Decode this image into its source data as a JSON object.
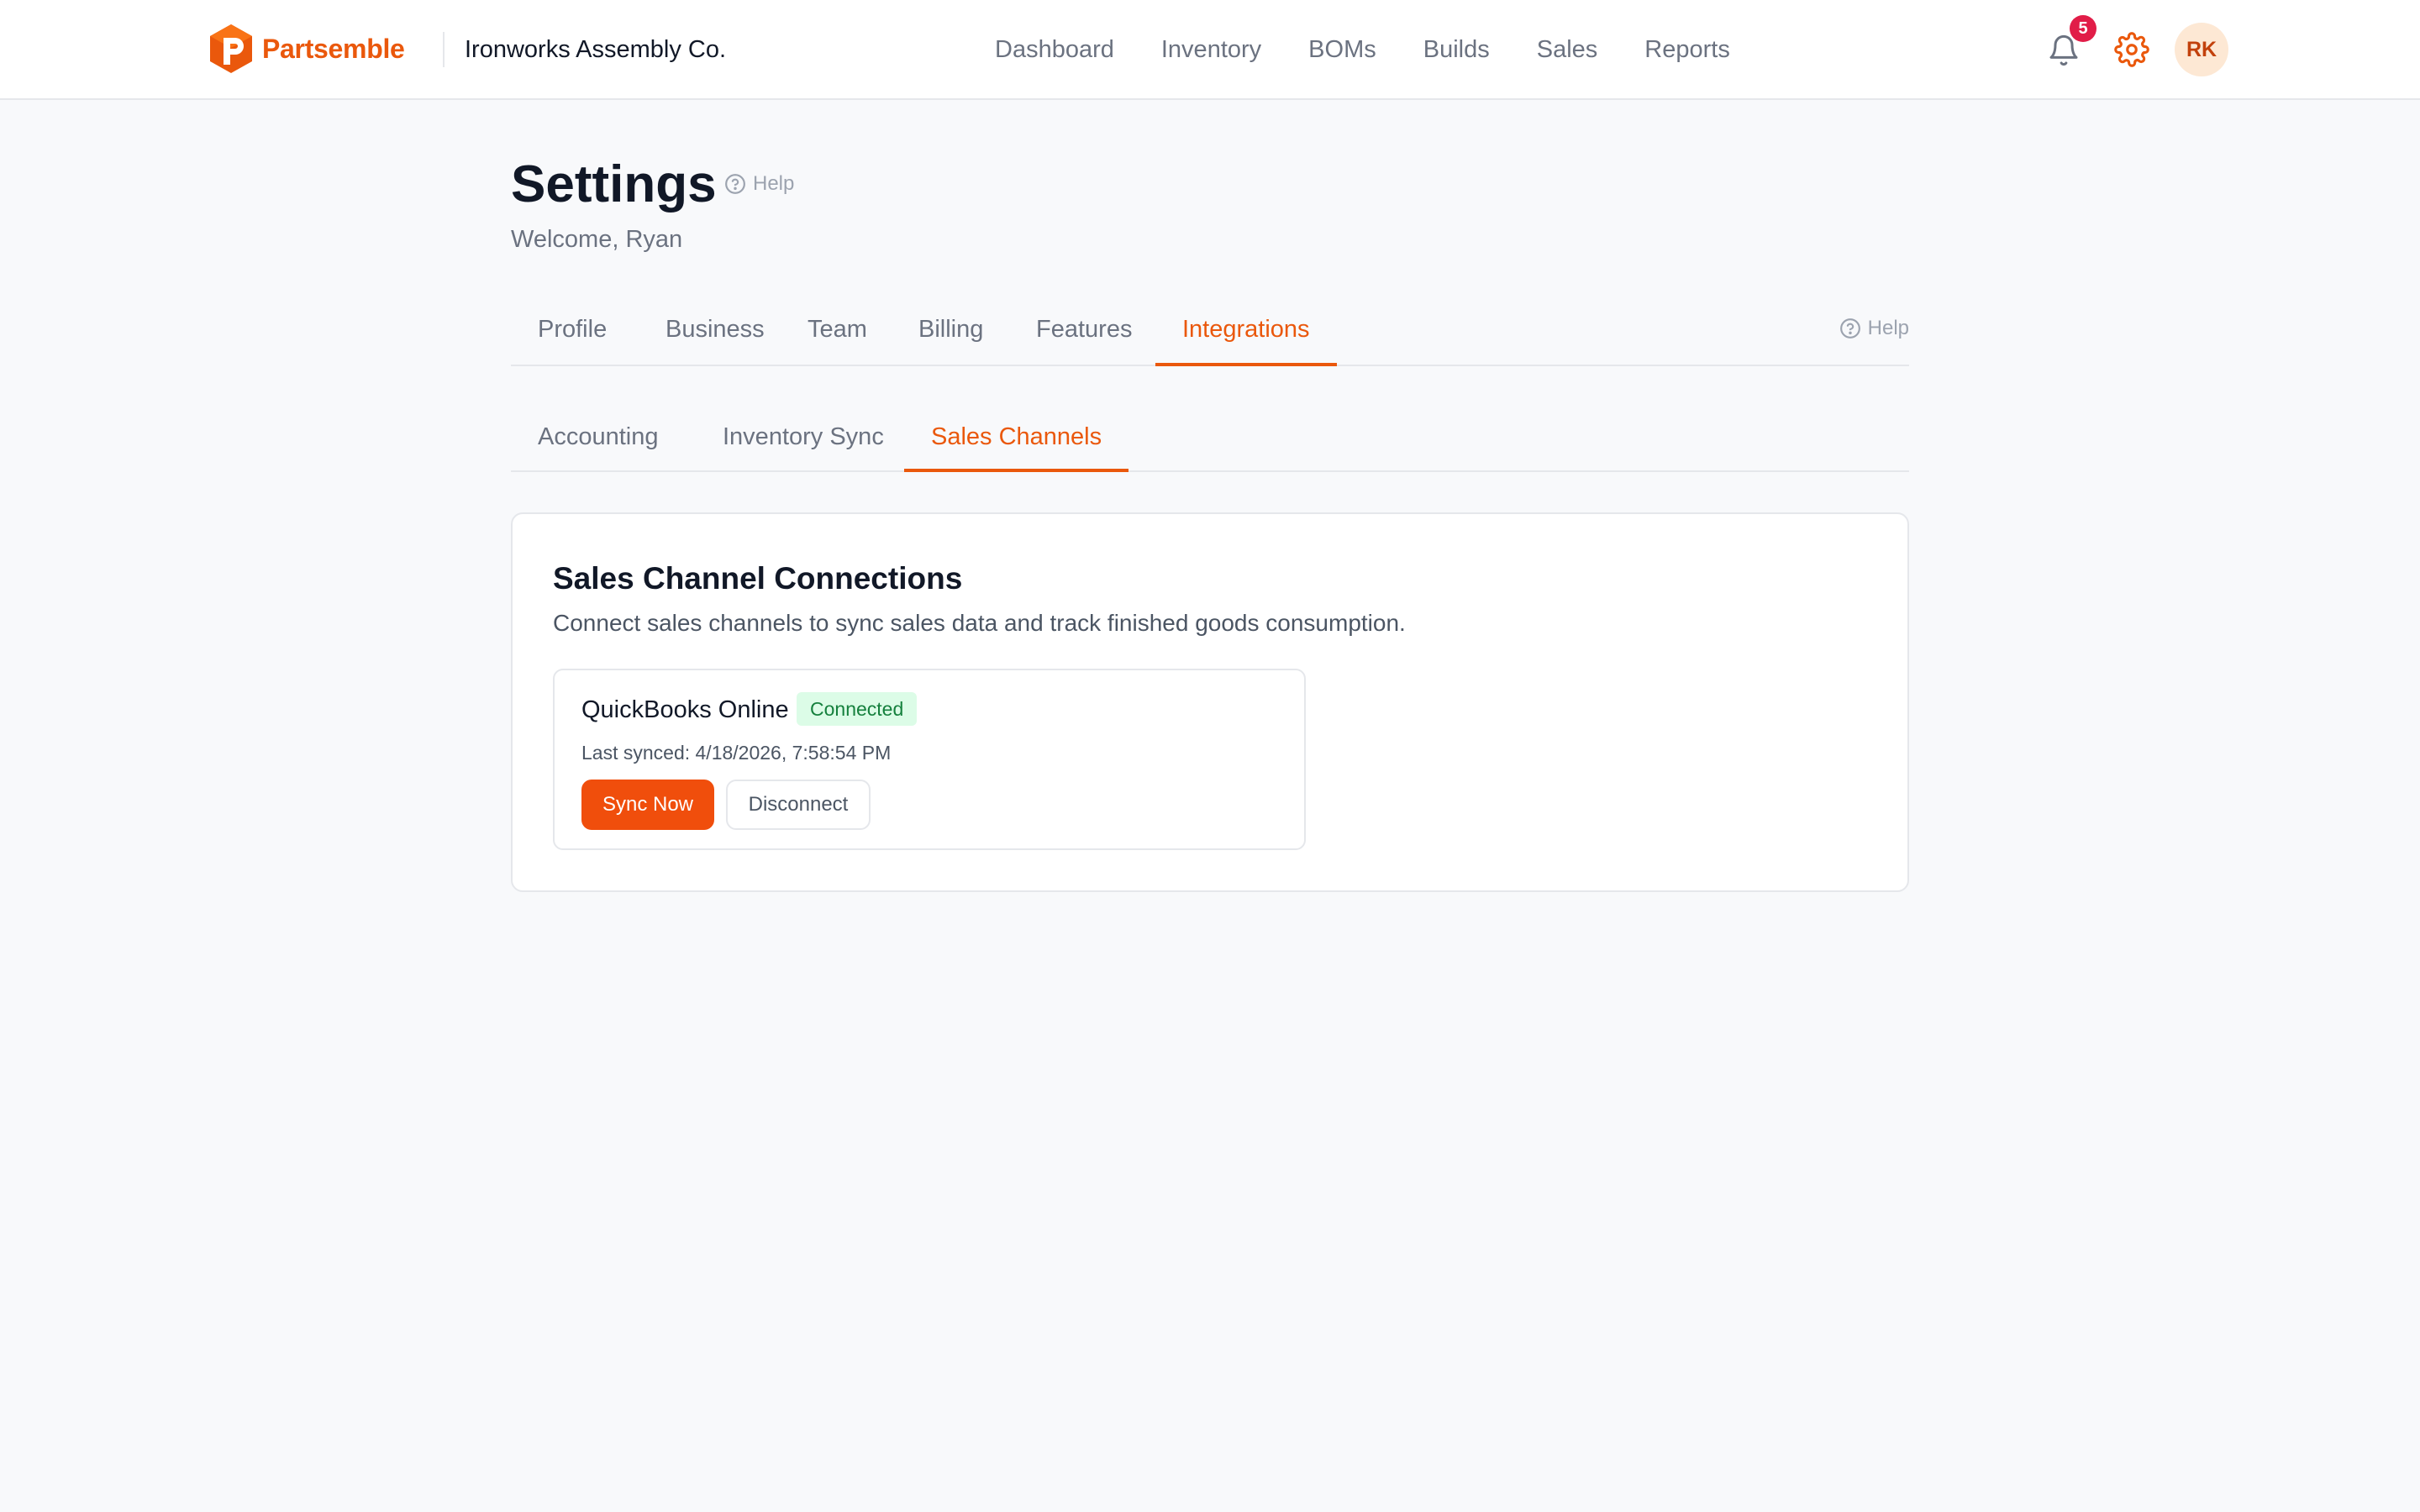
{
  "colors": {
    "accent": "#ea580c",
    "primary_button": "#f04e0c",
    "badge": "#e11d48",
    "connected_bg": "#dcfce7",
    "connected_text": "#15803d",
    "avatar_bg": "#fde8d4"
  },
  "header": {
    "brand": "Partsemble",
    "brand_icon": "partsemble-logo",
    "company": "Ironworks Assembly Co.",
    "nav": [
      {
        "label": "Dashboard"
      },
      {
        "label": "Inventory"
      },
      {
        "label": "BOMs"
      },
      {
        "label": "Builds"
      },
      {
        "label": "Sales"
      },
      {
        "label": "Reports"
      }
    ],
    "notifications": {
      "icon": "bell-icon",
      "count": "5"
    },
    "settings_icon": "gear-icon",
    "avatar_initials": "RK"
  },
  "page": {
    "title": "Settings",
    "help_label": "Help",
    "welcome": "Welcome, Ryan"
  },
  "tabs": {
    "items": [
      {
        "label": "Profile"
      },
      {
        "label": "Business"
      },
      {
        "label": "Team"
      },
      {
        "label": "Billing"
      },
      {
        "label": "Features"
      },
      {
        "label": "Integrations",
        "active": true
      }
    ],
    "help_label": "Help"
  },
  "subtabs": {
    "items": [
      {
        "label": "Accounting"
      },
      {
        "label": "Inventory Sync"
      },
      {
        "label": "Sales Channels",
        "active": true
      }
    ]
  },
  "card": {
    "title": "Sales Channel Connections",
    "description": "Connect sales channels to sync sales data and track finished goods consumption.",
    "connection": {
      "name": "QuickBooks Online",
      "status": "Connected",
      "last_synced": "Last synced: 4/18/2026, 7:58:54 PM",
      "sync_label": "Sync Now",
      "disconnect_label": "Disconnect"
    }
  }
}
